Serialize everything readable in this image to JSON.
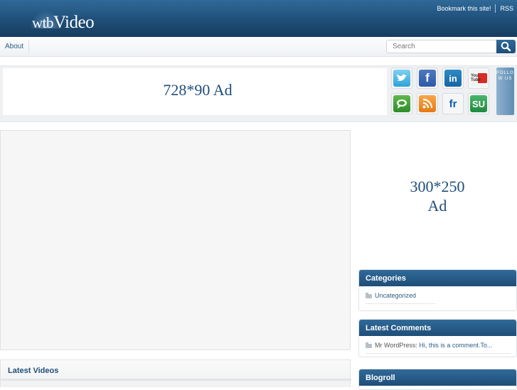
{
  "site": {
    "logo_part1": "wtb",
    "logo_part2": "Video",
    "top_links": [
      "Bookmark this site!",
      "RSS"
    ]
  },
  "nav": {
    "items": [
      "About"
    ],
    "search_placeholder": "Search"
  },
  "banner": {
    "ad_label": "728*90 Ad",
    "follow_label": "FOLLOW US",
    "social_icons": [
      "twitter-icon",
      "facebook-icon",
      "linkedin-icon",
      "youtube-icon",
      "friendfeed-icon",
      "rss-icon",
      "flickr-icon",
      "stumbleupon-icon"
    ],
    "youtube_text": "You Tube",
    "flickr_text": "fr",
    "linkedin_text": "in",
    "facebook_text": "f",
    "stumbleupon_text": "SU"
  },
  "main": {
    "latest_videos_title": "Latest Videos"
  },
  "sidebar": {
    "ad_label": "300*250\nAd",
    "categories": {
      "title": "Categories",
      "items": [
        "Uncategorized"
      ]
    },
    "latest_comments": {
      "title": "Latest Comments",
      "author": "Mr WordPress:",
      "comment": "Hi, this is a comment.To..."
    },
    "blogroll": {
      "title": "Blogroll"
    }
  },
  "colors": {
    "header_blue": "#1f4e78",
    "link_blue": "#2a5d8a",
    "widget_title_blue": "#2f6a99"
  }
}
